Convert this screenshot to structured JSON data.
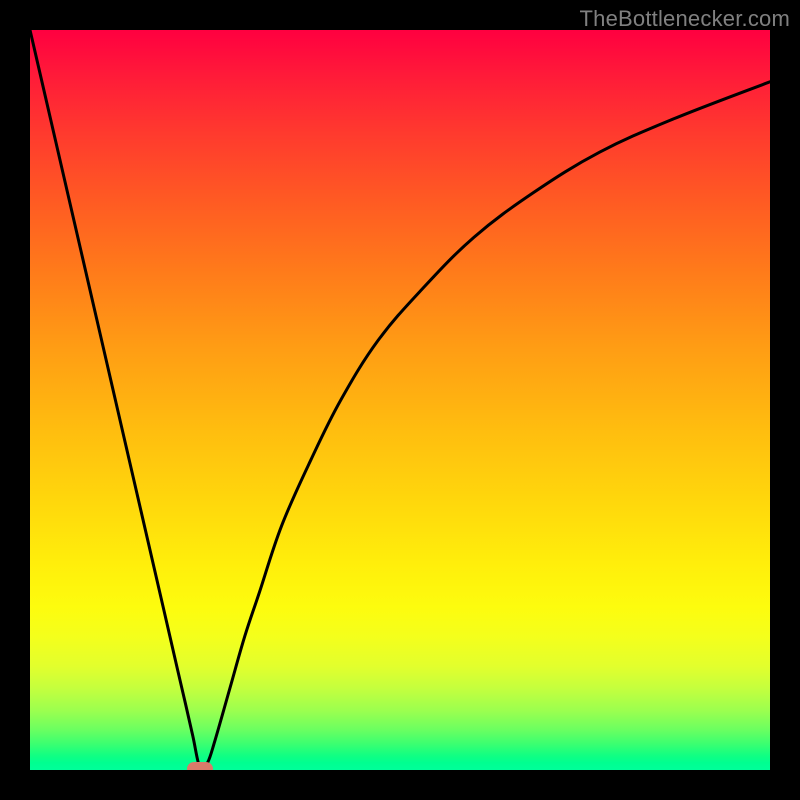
{
  "watermark": "TheBottlenecker.com",
  "colors": {
    "frame": "#000000",
    "curve": "#000000",
    "marker": "#d97a6a",
    "watermark": "#808080",
    "gradient_top": "#ff0040",
    "gradient_bottom": "#00ff9a"
  },
  "chart_data": {
    "type": "line",
    "title": "",
    "xlabel": "",
    "ylabel": "",
    "xlim": [
      0,
      100
    ],
    "ylim": [
      0,
      100
    ],
    "x": [
      0,
      3,
      6,
      9,
      12,
      15,
      18,
      20,
      21,
      22,
      23,
      24,
      25,
      27,
      29,
      31,
      34,
      38,
      42,
      47,
      53,
      60,
      68,
      77,
      87,
      100
    ],
    "values": [
      100,
      87,
      74,
      61,
      48,
      35,
      22,
      13.3,
      9,
      4.6,
      0.2,
      1,
      4,
      11,
      18,
      24,
      33,
      42,
      50,
      58,
      65,
      72,
      78,
      83.5,
      88,
      93
    ],
    "optimum_marker": {
      "x": 23,
      "y": 0.2
    },
    "grid": false,
    "legend": false,
    "annotations": []
  }
}
